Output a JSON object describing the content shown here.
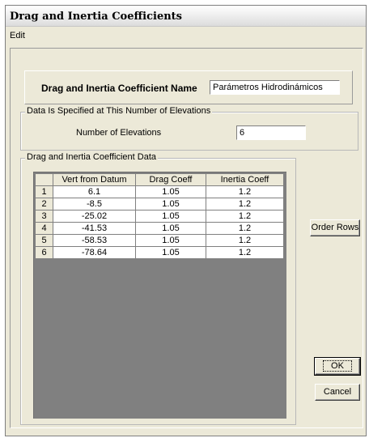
{
  "window": {
    "title": "Drag and Inertia Coefficients"
  },
  "menu": {
    "items": [
      "Edit"
    ]
  },
  "name_section": {
    "label": "Drag and Inertia Coefficient Name",
    "value": "Parámetros Hidrodinámicos"
  },
  "elevations_section": {
    "title": "Data Is Specified at This Number of Elevations",
    "label": "Number of Elevations",
    "value": "6"
  },
  "data_section": {
    "title": "Drag and Inertia Coefficient Data",
    "columns": [
      "Vert from Datum",
      "Drag Coeff",
      "Inertia Coeff"
    ],
    "rows": [
      [
        "1",
        "6.1",
        "1.05",
        "1.2"
      ],
      [
        "2",
        "-8.5",
        "1.05",
        "1.2"
      ],
      [
        "3",
        "-25.02",
        "1.05",
        "1.2"
      ],
      [
        "4",
        "-41.53",
        "1.05",
        "1.2"
      ],
      [
        "5",
        "-58.53",
        "1.05",
        "1.2"
      ],
      [
        "6",
        "-78.64",
        "1.05",
        "1.2"
      ]
    ]
  },
  "buttons": {
    "order_rows": "Order Rows",
    "ok": "OK",
    "cancel": "Cancel"
  }
}
